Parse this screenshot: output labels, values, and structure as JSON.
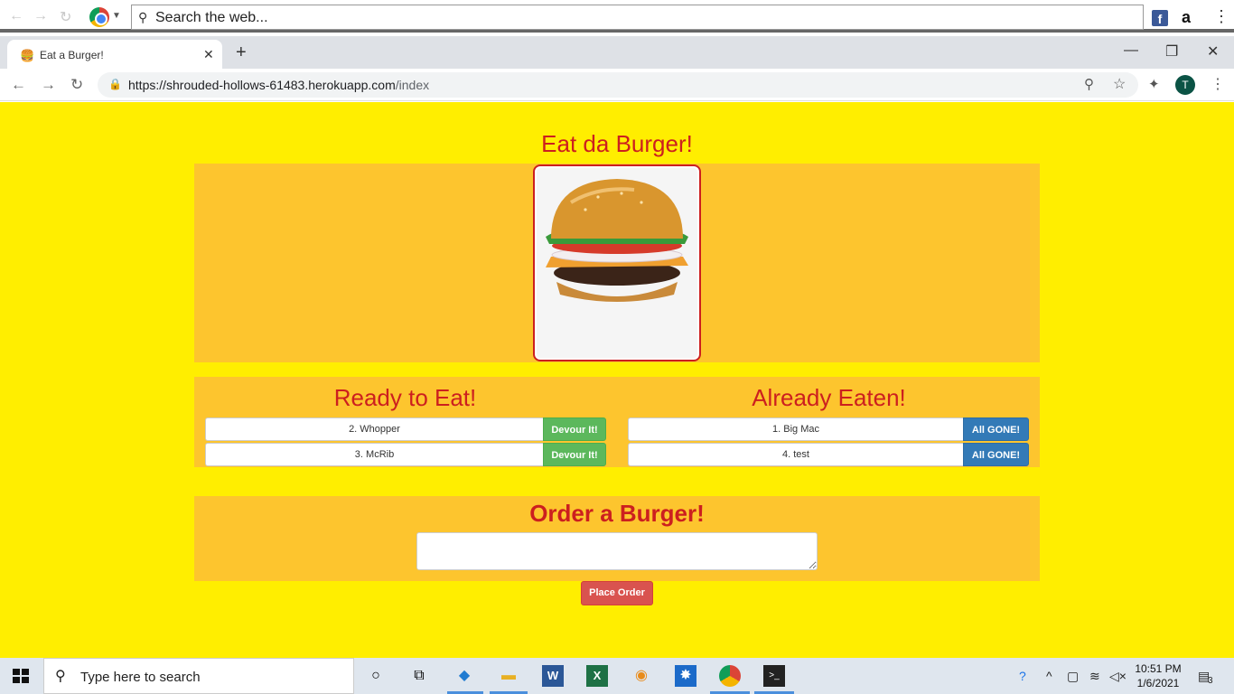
{
  "topbar": {
    "search_placeholder": "Search the web...",
    "amazon_letter": "a",
    "facebook_letter": "f"
  },
  "tab": {
    "title": "Eat a Burger!",
    "favicon": "🍔",
    "close": "✕",
    "new_tab": "+"
  },
  "window_controls": {
    "minimize": "—",
    "restore": "❐",
    "close": "✕"
  },
  "address": {
    "url_host": "https://shrouded-hollows-61483.herokuapp.com",
    "url_path": "/index",
    "avatar_letter": "T"
  },
  "page": {
    "title": "Eat da Burger!",
    "ready_title": "Ready to Eat!",
    "eaten_title": "Already Eaten!",
    "ready_items": [
      {
        "label": "2. Whopper",
        "button": "Devour It!"
      },
      {
        "label": "3. McRib",
        "button": "Devour It!"
      }
    ],
    "eaten_items": [
      {
        "label": "1. Big Mac",
        "button": "All GONE!"
      },
      {
        "label": "4. test",
        "button": "All GONE!"
      }
    ],
    "order_title": "Order a Burger!",
    "order_button": "Place Order"
  },
  "taskbar": {
    "search_placeholder": "Type here to search",
    "time": "10:51 PM",
    "date": "1/6/2021",
    "notification_count": "3"
  },
  "colors": {
    "page_bg": "#ffee00",
    "panel_bg": "#fdc52e",
    "heading_red": "#cc1f1f",
    "devour_green": "#5cb85c",
    "gone_blue": "#337ab7",
    "order_red": "#d9534f"
  }
}
